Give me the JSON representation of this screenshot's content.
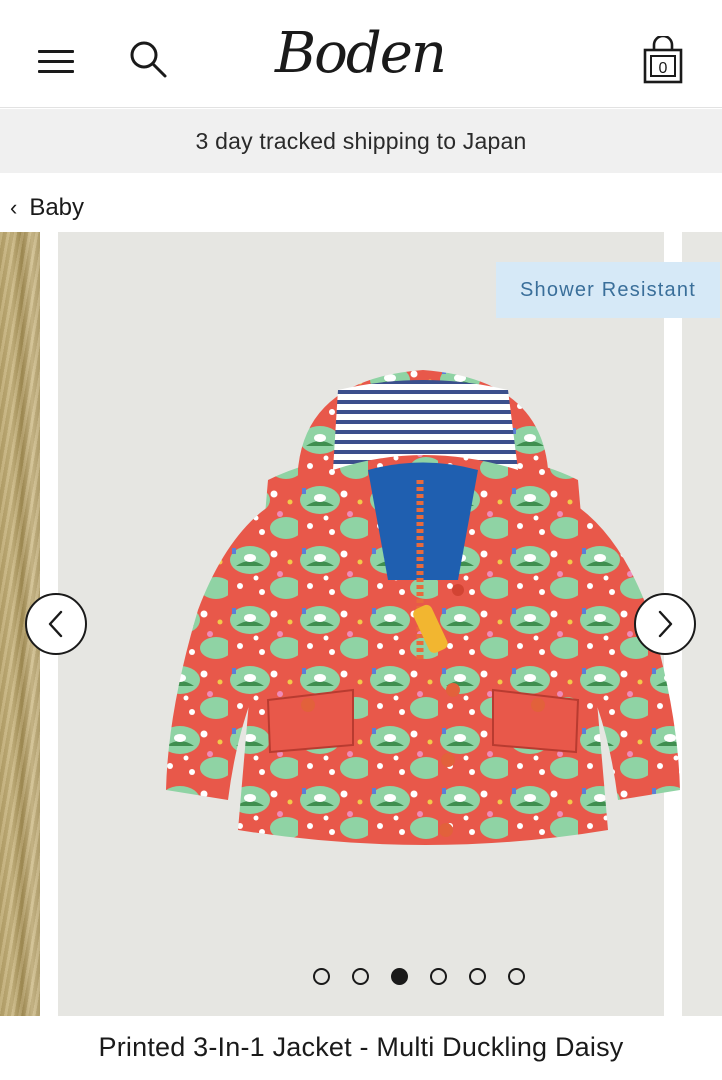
{
  "header": {
    "logo_text": "Boden",
    "menu_icon": "hamburger-menu-icon",
    "search_icon": "search-icon",
    "bag_icon": "shopping-bag-icon"
  },
  "shipping_bar": {
    "text": "3 day tracked shipping to Japan"
  },
  "breadcrumb": {
    "chevron": "‹",
    "label": "Baby"
  },
  "gallery": {
    "badge": "Shower Resistant",
    "slide_count": 6,
    "active_index": 2,
    "prev_icon": "chevron-left-icon",
    "next_icon": "chevron-right-icon"
  },
  "product": {
    "title": "Printed 3-In-1 Jacket - Multi Duckling Daisy"
  },
  "colors": {
    "badge_bg": "#d6e9f7",
    "badge_text": "#3a6f9a",
    "shipping_bg": "#f0f0f0",
    "jacket_red": "#e8584a",
    "jacket_green": "#8fd3a4"
  }
}
